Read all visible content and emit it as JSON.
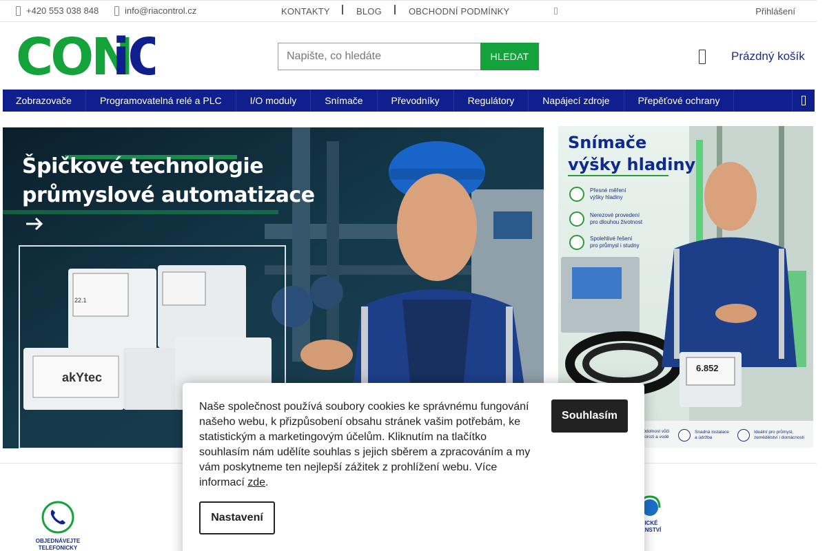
{
  "topbar": {
    "phone": "+420 553 038 848",
    "email": "info@riacontrol.cz",
    "links": [
      "KONTAKTY",
      "BLOG",
      "OBCHODNÍ PODMÍNKY"
    ],
    "login": "Přihlášení"
  },
  "header": {
    "logo_text": "CONiO",
    "search_placeholder": "Napište, co hledáte",
    "search_button": "HLEDAT",
    "cart": "Prázdný košík"
  },
  "mainnav": {
    "items": [
      "Zobrazovače",
      "Programovatelná relé a PLC",
      "I/O moduly",
      "Snímače",
      "Převodníky",
      "Regulátory",
      "Napájecí zdroje",
      "Přepěťové ochrany"
    ]
  },
  "banners": {
    "main": {
      "line1": "Špičkové technologie",
      "line2": "průmyslové automatizace",
      "device_brand": "akYtec",
      "device_value": "22.1"
    },
    "side": {
      "line1": "Snímače",
      "line2": "výšky hladiny",
      "features": [
        {
          "a": "Přesné měření",
          "b": "výšky hladiny"
        },
        {
          "a": "Nerezové provedení",
          "b": "pro dlouhou životnost"
        },
        {
          "a": "Spolehlivé řešení",
          "b": "pro průmysl i studny"
        }
      ],
      "display_value": "6.852",
      "bottom_features": [
        {
          "a": "Odolnost vůči",
          "b": "korozi a vodě"
        },
        {
          "a": "Snadná instalace",
          "b": "a údržba"
        },
        {
          "a": "Ideální pro průmysl,",
          "b": "zemědělství i domácnosti"
        }
      ]
    }
  },
  "benefits": {
    "left": {
      "a": "OBJEDNÁVEJTE",
      "b": "TELEFONICKY"
    },
    "right": {
      "a": "NICKÉ",
      "b": "DENSTVÍ"
    }
  },
  "cookie": {
    "text": "Naše společnost používá soubory cookies ke správnému fungování našeho webu, k přizpůsobení obsahu stránek vašim potřebám, ke statistickým a marketingovým účelům. Kliknutím na tlačítko souhlasím nám udělíte souhlas s jejich sběrem a zpracováním a my vám poskytneme ten nejlepší zážitek z prohlížení webu. Více informací ",
    "link": "zde",
    "end": ".",
    "agree": "Souhlasím",
    "settings": "Nastavení"
  },
  "colors": {
    "brand_green": "#14a23a",
    "brand_blue": "#0f1f8e"
  }
}
